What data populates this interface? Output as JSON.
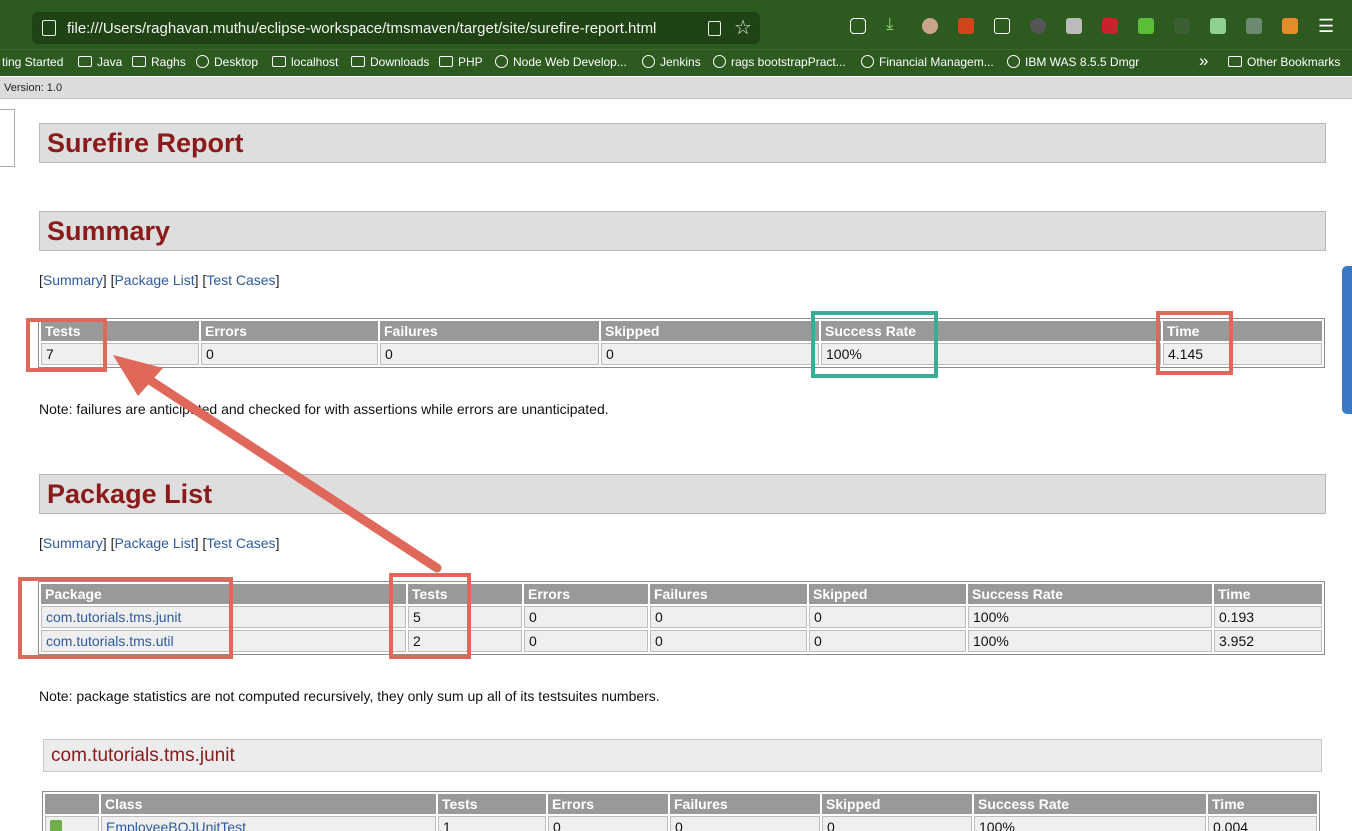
{
  "browser": {
    "url": "file:///Users/raghavan.muthu/eclipse-workspace/tmsmaven/target/site/surefire-report.html",
    "bookmarks": [
      "ting Started",
      "Java",
      "Raghs",
      "Desktop",
      "localhost",
      "Downloads",
      "PHP",
      "Node Web Develop...",
      "Jenkins",
      "rags bootstrapPract...",
      "Financial Managem...",
      "IBM WAS 8.5.5 Dmgr"
    ],
    "overflow": "»",
    "other_bookmarks": "Other Bookmarks",
    "colors": {
      "toolbar": "#2c5a1f",
      "accent_annotation": "#e0685a",
      "annotation_green": "#3aac98"
    }
  },
  "page": {
    "version": "Version: 1.0",
    "report_title": "Surefire Report",
    "summary_title": "Summary",
    "nav": {
      "summary": "Summary",
      "package_list": "Package List",
      "test_cases": "Test Cases"
    },
    "summary_table": {
      "headers": [
        "Tests",
        "Errors",
        "Failures",
        "Skipped",
        "Success Rate",
        "Time"
      ],
      "row": [
        "7",
        "0",
        "0",
        "0",
        "100%",
        "4.145"
      ]
    },
    "summary_note": "Note: failures are anticipated and checked for with assertions while errors are unanticipated.",
    "package_list_title": "Package List",
    "package_table": {
      "headers": [
        "Package",
        "Tests",
        "Errors",
        "Failures",
        "Skipped",
        "Success Rate",
        "Time"
      ],
      "rows": [
        [
          "com.tutorials.tms.junit",
          "5",
          "0",
          "0",
          "0",
          "100%",
          "0.193"
        ],
        [
          "com.tutorials.tms.util",
          "2",
          "0",
          "0",
          "0",
          "100%",
          "3.952"
        ]
      ]
    },
    "package_note": "Note: package statistics are not computed recursively, they only sum up all of its testsuites numbers.",
    "junit_section_title": "com.tutorials.tms.junit",
    "class_table": {
      "headers": [
        "",
        "Class",
        "Tests",
        "Errors",
        "Failures",
        "Skipped",
        "Success Rate",
        "Time"
      ],
      "rows": [
        [
          "",
          "EmployeeBOJUnitTest",
          "1",
          "0",
          "0",
          "0",
          "100%",
          "0.004"
        ]
      ]
    }
  }
}
